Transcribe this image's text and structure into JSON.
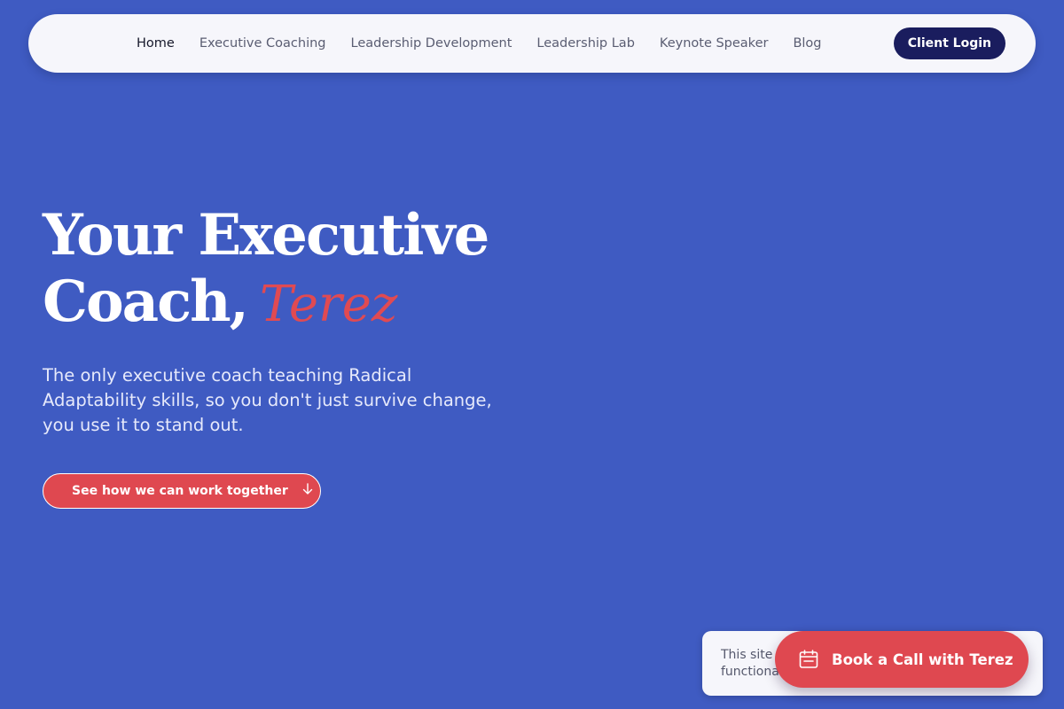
{
  "nav": {
    "items": [
      {
        "label": "Home",
        "active": true
      },
      {
        "label": "Executive Coaching",
        "active": false
      },
      {
        "label": "Leadership Development",
        "active": false
      },
      {
        "label": "Leadership Lab",
        "active": false
      },
      {
        "label": "Keynote Speaker",
        "active": false
      },
      {
        "label": "Blog",
        "active": false
      }
    ],
    "login_label": "Client Login"
  },
  "hero": {
    "title_line1": "Your Executive",
    "title_line2": "Coach,",
    "title_name": "Terez",
    "subtitle": "The only executive coach teaching Radical Adaptability skills, so you don't just survive change, you use it to stand out.",
    "cta_label": "See how we can work together",
    "cta_icon": "arrow-down-icon"
  },
  "cookie": {
    "line1": "This site u",
    "line2": "functiona"
  },
  "booking": {
    "label": "Book a Call with Terez",
    "icon": "calendar-icon"
  },
  "colors": {
    "background": "#3f5bc2",
    "accent": "#df4850",
    "nav_bg": "#f6f6fb",
    "login_bg": "#1a1d5e"
  }
}
